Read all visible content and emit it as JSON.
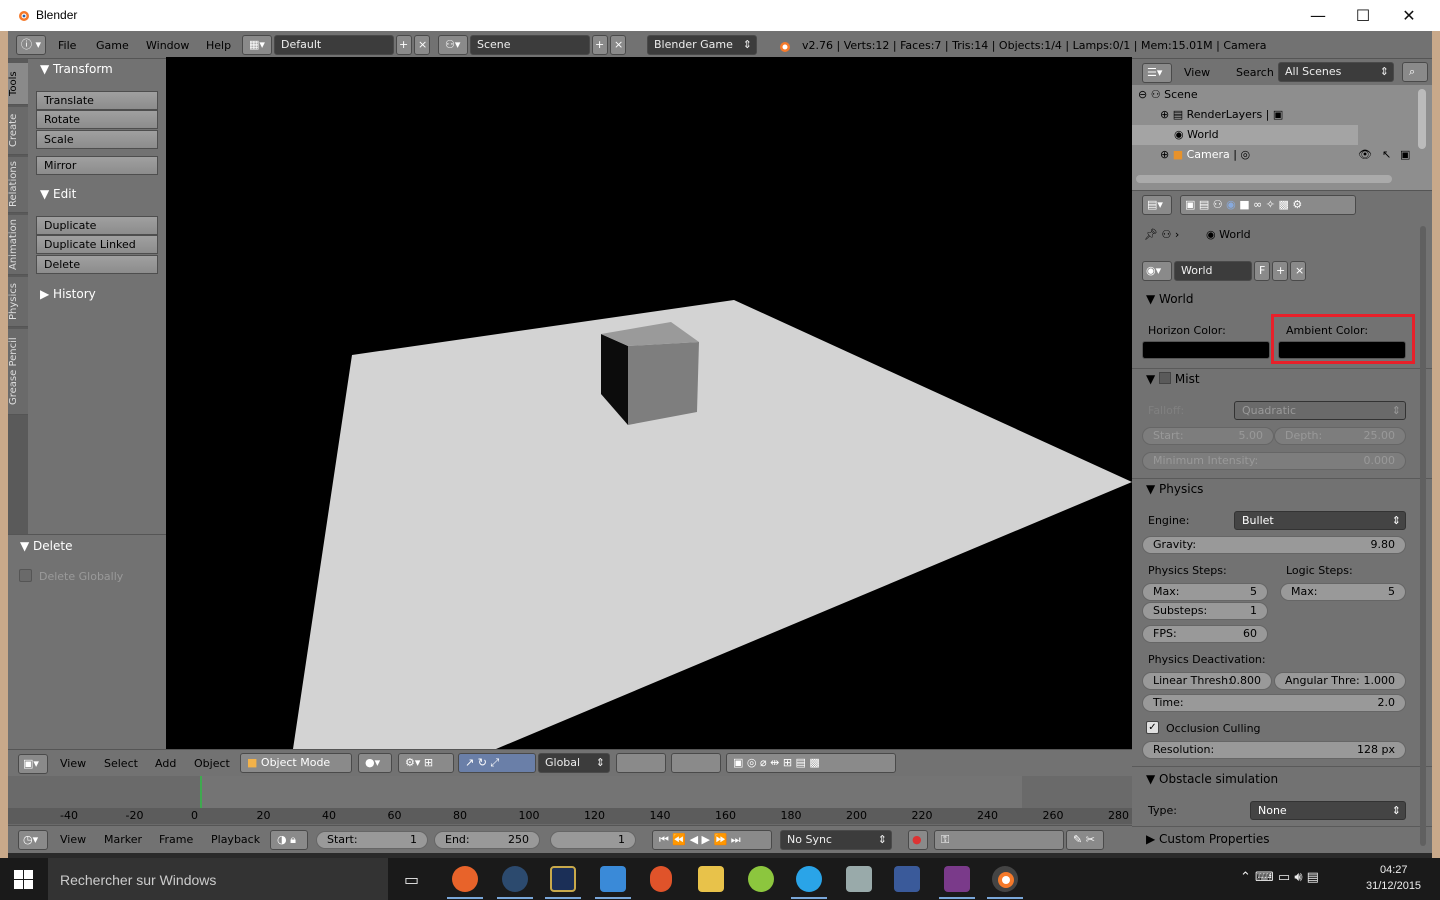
{
  "window": {
    "title": "Blender",
    "minimize": "—",
    "maximize": "☐",
    "close": "✕"
  },
  "menu": {
    "items": [
      "File",
      "Game",
      "Window",
      "Help"
    ]
  },
  "layout_field": "Default",
  "scene_field": "Scene",
  "engine_field": "Blender Game",
  "info_text": "v2.76 | Verts:12 | Faces:7 | Tris:14 | Objects:1/4 | Lamps:0/1 | Mem:15.01M | Camera",
  "tool_tabs": [
    "Tools",
    "Create",
    "Relations",
    "Animation",
    "Physics",
    "Grease Pencil"
  ],
  "tools": {
    "transform_title": "Transform",
    "transform_buttons": [
      "Translate",
      "Rotate",
      "Scale",
      "Mirror"
    ],
    "edit_title": "Edit",
    "edit_buttons": [
      "Duplicate",
      "Duplicate Linked",
      "Delete"
    ],
    "history_title": "History"
  },
  "operator": {
    "title": "Delete",
    "checkbox_label": "Delete Globally"
  },
  "view3d_header": {
    "menus": [
      "View",
      "Select",
      "Add",
      "Object"
    ],
    "mode": "Object Mode",
    "orientation": "Global"
  },
  "timeline": {
    "ticks": [
      "-40",
      "-20",
      "0",
      "20",
      "40",
      "60",
      "80",
      "100",
      "120",
      "140",
      "160",
      "180",
      "200",
      "220",
      "240",
      "260",
      "280"
    ],
    "menus": [
      "View",
      "Marker",
      "Frame",
      "Playback"
    ],
    "start_label": "Start:",
    "start_value": "1",
    "end_label": "End:",
    "end_value": "250",
    "current_frame": "1",
    "sync": "No Sync"
  },
  "outliner": {
    "menus": [
      "View",
      "Search"
    ],
    "filter": "All Scenes",
    "rows": [
      "Scene",
      "RenderLayers",
      "World",
      "Camera"
    ]
  },
  "properties": {
    "breadcrumb": "World",
    "world_datablock": "World",
    "world_fake": "F",
    "world_panel": "World",
    "horizon_label": "Horizon Color:",
    "ambient_label": "Ambient Color:",
    "horizon_color": "#000000",
    "ambient_color": "#000000",
    "highlight_color": "#e8202a",
    "mist_panel": "Mist",
    "falloff_label": "Falloff:",
    "falloff_value": "Quadratic",
    "start_label": "Start:",
    "start_value": "5.00",
    "depth_label": "Depth:",
    "depth_value": "25.00",
    "min_intensity_label": "Minimum Intensity:",
    "min_intensity_value": "0.000",
    "physics_panel": "Physics",
    "engine_label": "Engine:",
    "engine_value": "Bullet",
    "gravity_label": "Gravity:",
    "gravity_value": "9.80",
    "physics_steps_label": "Physics Steps:",
    "logic_steps_label": "Logic Steps:",
    "max_label": "Max:",
    "max_value": "5",
    "logic_max_label": "Max:",
    "logic_max_value": "5",
    "substeps_label": "Substeps:",
    "substeps_value": "1",
    "fps_label": "FPS:",
    "fps_value": "60",
    "deactivation_label": "Physics Deactivation:",
    "linear_label": "Linear Thresh:",
    "linear_value": "0.800",
    "angular_label": "Angular Thre:",
    "angular_value": "1.000",
    "time_label": "Time:",
    "time_value": "2.0",
    "occlusion_label": "Occlusion Culling",
    "resolution_label": "Resolution:",
    "resolution_value": "128 px",
    "obstacle_panel": "Obstacle simulation",
    "type_label": "Type:",
    "type_value": "None",
    "custom_panel": "Custom Properties"
  },
  "taskbar": {
    "search": "Rechercher sur Windows",
    "time": "04:27",
    "date": "31/12/2015"
  }
}
